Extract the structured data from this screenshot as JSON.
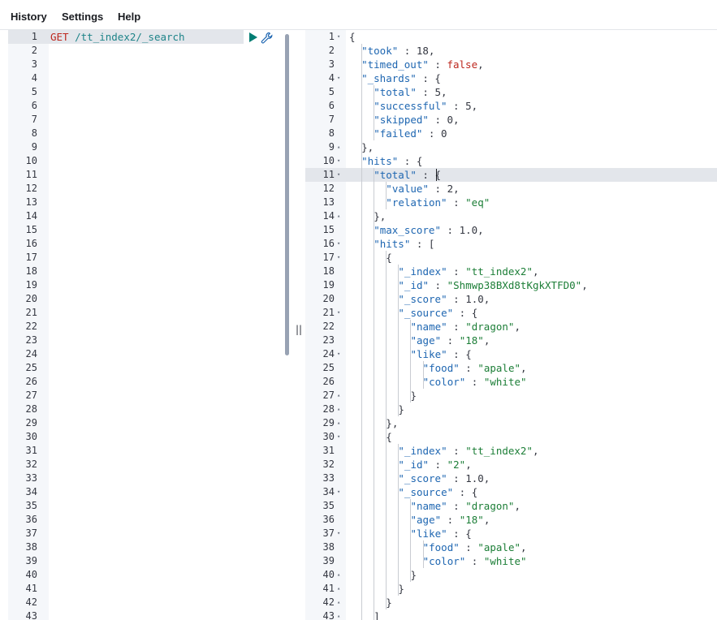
{
  "menu": {
    "history": "History",
    "settings": "Settings",
    "help": "Help"
  },
  "request": {
    "method": "GET",
    "path": "/tt_index2/_search",
    "line_numbers": [
      "1",
      "2",
      "3",
      "4",
      "5",
      "6",
      "7",
      "8",
      "9",
      "10",
      "11",
      "12",
      "13",
      "14",
      "15",
      "16",
      "17",
      "18",
      "19",
      "20",
      "21",
      "22",
      "23",
      "24",
      "25",
      "26",
      "27",
      "28",
      "29",
      "30",
      "31",
      "32",
      "33",
      "34",
      "35",
      "36",
      "37",
      "38",
      "39",
      "40",
      "41",
      "42",
      "43"
    ]
  },
  "response": {
    "lines": [
      {
        "n": "1",
        "fold": "▾",
        "indent": 0,
        "parts": [
          [
            "p",
            "{"
          ]
        ]
      },
      {
        "n": "2",
        "indent": 1,
        "parts": [
          [
            "k",
            "\"took\""
          ],
          [
            "p",
            " : "
          ],
          [
            "n",
            "18"
          ],
          [
            "p",
            ","
          ]
        ]
      },
      {
        "n": "3",
        "indent": 1,
        "parts": [
          [
            "k",
            "\"timed_out\""
          ],
          [
            "p",
            " : "
          ],
          [
            "b",
            "false"
          ],
          [
            "p",
            ","
          ]
        ]
      },
      {
        "n": "4",
        "fold": "▾",
        "indent": 1,
        "parts": [
          [
            "k",
            "\"_shards\""
          ],
          [
            "p",
            " : {"
          ]
        ]
      },
      {
        "n": "5",
        "indent": 2,
        "parts": [
          [
            "k",
            "\"total\""
          ],
          [
            "p",
            " : "
          ],
          [
            "n",
            "5"
          ],
          [
            "p",
            ","
          ]
        ]
      },
      {
        "n": "6",
        "indent": 2,
        "parts": [
          [
            "k",
            "\"successful\""
          ],
          [
            "p",
            " : "
          ],
          [
            "n",
            "5"
          ],
          [
            "p",
            ","
          ]
        ]
      },
      {
        "n": "7",
        "indent": 2,
        "parts": [
          [
            "k",
            "\"skipped\""
          ],
          [
            "p",
            " : "
          ],
          [
            "n",
            "0"
          ],
          [
            "p",
            ","
          ]
        ]
      },
      {
        "n": "8",
        "indent": 2,
        "parts": [
          [
            "k",
            "\"failed\""
          ],
          [
            "p",
            " : "
          ],
          [
            "n",
            "0"
          ]
        ]
      },
      {
        "n": "9",
        "fold": "▴",
        "indent": 1,
        "parts": [
          [
            "p",
            "},"
          ]
        ]
      },
      {
        "n": "10",
        "fold": "▾",
        "indent": 1,
        "parts": [
          [
            "k",
            "\"hits\""
          ],
          [
            "p",
            " : {"
          ]
        ]
      },
      {
        "n": "11",
        "fold": "▾",
        "indent": 2,
        "parts": [
          [
            "k",
            "\"total\""
          ],
          [
            "p",
            " : {"
          ]
        ]
      },
      {
        "n": "12",
        "indent": 3,
        "parts": [
          [
            "k",
            "\"value\""
          ],
          [
            "p",
            " : "
          ],
          [
            "n",
            "2"
          ],
          [
            "p",
            ","
          ]
        ]
      },
      {
        "n": "13",
        "indent": 3,
        "parts": [
          [
            "k",
            "\"relation\""
          ],
          [
            "p",
            " : "
          ],
          [
            "s",
            "\"eq\""
          ]
        ]
      },
      {
        "n": "14",
        "fold": "▴",
        "indent": 2,
        "parts": [
          [
            "p",
            "},"
          ]
        ]
      },
      {
        "n": "15",
        "indent": 2,
        "parts": [
          [
            "k",
            "\"max_score\""
          ],
          [
            "p",
            " : "
          ],
          [
            "n",
            "1.0"
          ],
          [
            "p",
            ","
          ]
        ]
      },
      {
        "n": "16",
        "fold": "▾",
        "indent": 2,
        "parts": [
          [
            "k",
            "\"hits\""
          ],
          [
            "p",
            " : ["
          ]
        ]
      },
      {
        "n": "17",
        "fold": "▾",
        "indent": 3,
        "parts": [
          [
            "p",
            "{"
          ]
        ]
      },
      {
        "n": "18",
        "indent": 4,
        "parts": [
          [
            "k",
            "\"_index\""
          ],
          [
            "p",
            " : "
          ],
          [
            "s",
            "\"tt_index2\""
          ],
          [
            "p",
            ","
          ]
        ]
      },
      {
        "n": "19",
        "indent": 4,
        "parts": [
          [
            "k",
            "\"_id\""
          ],
          [
            "p",
            " : "
          ],
          [
            "s",
            "\"Shmwp38BXd8tKgkXTFD0\""
          ],
          [
            "p",
            ","
          ]
        ]
      },
      {
        "n": "20",
        "indent": 4,
        "parts": [
          [
            "k",
            "\"_score\""
          ],
          [
            "p",
            " : "
          ],
          [
            "n",
            "1.0"
          ],
          [
            "p",
            ","
          ]
        ]
      },
      {
        "n": "21",
        "fold": "▾",
        "indent": 4,
        "parts": [
          [
            "k",
            "\"_source\""
          ],
          [
            "p",
            " : {"
          ]
        ]
      },
      {
        "n": "22",
        "indent": 5,
        "parts": [
          [
            "k",
            "\"name\""
          ],
          [
            "p",
            " : "
          ],
          [
            "s",
            "\"dragon\""
          ],
          [
            "p",
            ","
          ]
        ]
      },
      {
        "n": "23",
        "indent": 5,
        "parts": [
          [
            "k",
            "\"age\""
          ],
          [
            "p",
            " : "
          ],
          [
            "s",
            "\"18\""
          ],
          [
            "p",
            ","
          ]
        ]
      },
      {
        "n": "24",
        "fold": "▾",
        "indent": 5,
        "parts": [
          [
            "k",
            "\"like\""
          ],
          [
            "p",
            " : {"
          ]
        ]
      },
      {
        "n": "25",
        "indent": 6,
        "parts": [
          [
            "k",
            "\"food\""
          ],
          [
            "p",
            " : "
          ],
          [
            "s",
            "\"apale\""
          ],
          [
            "p",
            ","
          ]
        ]
      },
      {
        "n": "26",
        "indent": 6,
        "parts": [
          [
            "k",
            "\"color\""
          ],
          [
            "p",
            " : "
          ],
          [
            "s",
            "\"white\""
          ]
        ]
      },
      {
        "n": "27",
        "fold": "▴",
        "indent": 5,
        "parts": [
          [
            "p",
            "}"
          ]
        ]
      },
      {
        "n": "28",
        "fold": "▴",
        "indent": 4,
        "parts": [
          [
            "p",
            "}"
          ]
        ]
      },
      {
        "n": "29",
        "fold": "▴",
        "indent": 3,
        "parts": [
          [
            "p",
            "},"
          ]
        ]
      },
      {
        "n": "30",
        "fold": "▾",
        "indent": 3,
        "parts": [
          [
            "p",
            "{"
          ]
        ]
      },
      {
        "n": "31",
        "indent": 4,
        "parts": [
          [
            "k",
            "\"_index\""
          ],
          [
            "p",
            " : "
          ],
          [
            "s",
            "\"tt_index2\""
          ],
          [
            "p",
            ","
          ]
        ]
      },
      {
        "n": "32",
        "indent": 4,
        "parts": [
          [
            "k",
            "\"_id\""
          ],
          [
            "p",
            " : "
          ],
          [
            "s",
            "\"2\""
          ],
          [
            "p",
            ","
          ]
        ]
      },
      {
        "n": "33",
        "indent": 4,
        "parts": [
          [
            "k",
            "\"_score\""
          ],
          [
            "p",
            " : "
          ],
          [
            "n",
            "1.0"
          ],
          [
            "p",
            ","
          ]
        ]
      },
      {
        "n": "34",
        "fold": "▾",
        "indent": 4,
        "parts": [
          [
            "k",
            "\"_source\""
          ],
          [
            "p",
            " : {"
          ]
        ]
      },
      {
        "n": "35",
        "indent": 5,
        "parts": [
          [
            "k",
            "\"name\""
          ],
          [
            "p",
            " : "
          ],
          [
            "s",
            "\"dragon\""
          ],
          [
            "p",
            ","
          ]
        ]
      },
      {
        "n": "36",
        "indent": 5,
        "parts": [
          [
            "k",
            "\"age\""
          ],
          [
            "p",
            " : "
          ],
          [
            "s",
            "\"18\""
          ],
          [
            "p",
            ","
          ]
        ]
      },
      {
        "n": "37",
        "fold": "▾",
        "indent": 5,
        "parts": [
          [
            "k",
            "\"like\""
          ],
          [
            "p",
            " : {"
          ]
        ]
      },
      {
        "n": "38",
        "indent": 6,
        "parts": [
          [
            "k",
            "\"food\""
          ],
          [
            "p",
            " : "
          ],
          [
            "s",
            "\"apale\""
          ],
          [
            "p",
            ","
          ]
        ]
      },
      {
        "n": "39",
        "indent": 6,
        "parts": [
          [
            "k",
            "\"color\""
          ],
          [
            "p",
            " : "
          ],
          [
            "s",
            "\"white\""
          ]
        ]
      },
      {
        "n": "40",
        "fold": "▴",
        "indent": 5,
        "parts": [
          [
            "p",
            "}"
          ]
        ]
      },
      {
        "n": "41",
        "fold": "▴",
        "indent": 4,
        "parts": [
          [
            "p",
            "}"
          ]
        ]
      },
      {
        "n": "42",
        "fold": "▴",
        "indent": 3,
        "parts": [
          [
            "p",
            "}"
          ]
        ]
      },
      {
        "n": "43",
        "fold": "▴",
        "indent": 2,
        "parts": [
          [
            "p",
            "]"
          ]
        ]
      }
    ]
  },
  "icons": {
    "run": "play-icon",
    "settings": "wrench-icon",
    "resize": "pane-resize-handle"
  },
  "colors": {
    "method": "#bd271e",
    "url": "#1e8489",
    "key": "#1e66b1",
    "string": "#1c7e37",
    "boolean": "#bd271e",
    "run": "#017d73"
  }
}
